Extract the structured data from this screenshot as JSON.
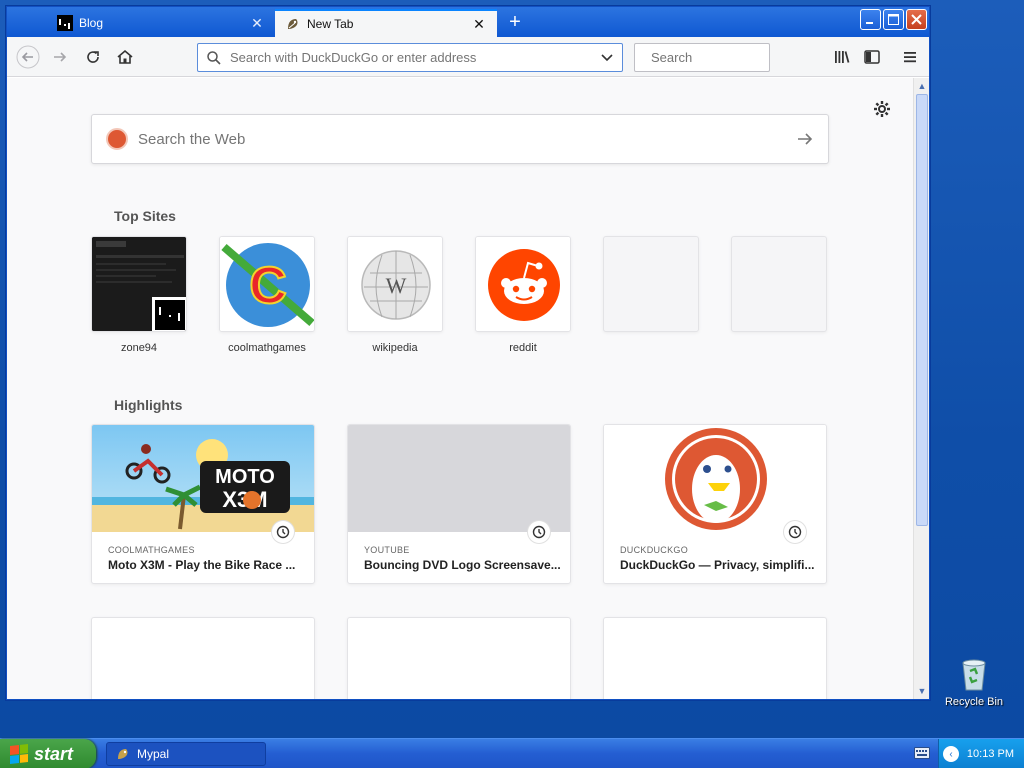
{
  "browser": {
    "tabs": [
      {
        "title": "Blog"
      },
      {
        "title": "New Tab"
      }
    ],
    "url_placeholder": "Search with DuckDuckGo or enter address",
    "search_placeholder": "Search"
  },
  "newtab": {
    "web_search_placeholder": "Search the Web",
    "top_sites_title": "Top Sites",
    "top_sites": [
      {
        "label": "zone94"
      },
      {
        "label": "coolmathgames"
      },
      {
        "label": "wikipedia"
      },
      {
        "label": "reddit"
      }
    ],
    "highlights_title": "Highlights",
    "highlights": [
      {
        "source": "COOLMATHGAMES",
        "title": "Moto X3M - Play the Bike Race ..."
      },
      {
        "source": "YOUTUBE",
        "title": "Bouncing DVD Logo Screensave..."
      },
      {
        "source": "DUCKDUCKGO",
        "title": "DuckDuckGo — Privacy, simplifi..."
      }
    ]
  },
  "desktop": {
    "recycle_bin": "Recycle Bin"
  },
  "taskbar": {
    "start": "start",
    "item": "Mypal",
    "clock": "10:13 PM"
  },
  "colors": {
    "accent": "#0a84ff",
    "reddit": "#ff4500",
    "duckduckgo": "#de5833",
    "taskbar": "#245ed2"
  }
}
